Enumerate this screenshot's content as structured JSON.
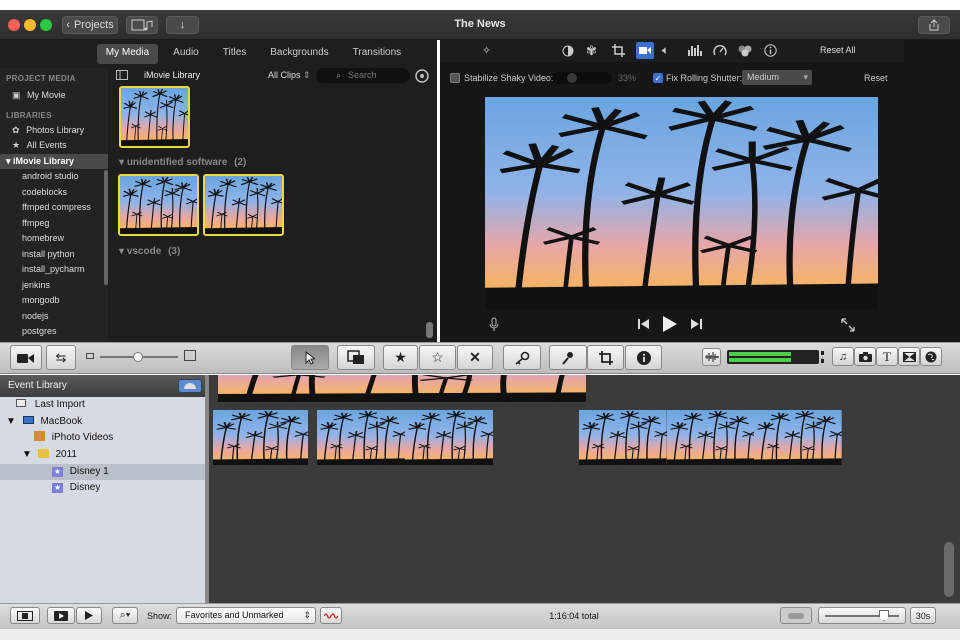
{
  "window": {
    "title": "The News",
    "projects_button": "Projects"
  },
  "media_tabs": [
    "My Media",
    "Audio",
    "Titles",
    "Backgrounds",
    "Transitions"
  ],
  "sidebar": {
    "project_media_header": "PROJECT MEDIA",
    "project": "My Movie",
    "libraries_header": "LIBRARIES",
    "photos_library": "Photos Library",
    "all_events": "All Events",
    "library": "iMovie Library",
    "events": [
      "android studio",
      "codeblocks",
      "ffmped compress",
      "ffmpeg",
      "homebrew",
      "install python",
      "install_pycharm",
      "jenkins",
      "mongodb",
      "nodejs",
      "postgres"
    ]
  },
  "browser": {
    "library_name": "iMovie Library",
    "filter": "All Clips",
    "search_placeholder": "Search",
    "groups": [
      {
        "name": "unidentified software",
        "count": "(2)"
      },
      {
        "name": "vscode",
        "count": "(3)"
      }
    ]
  },
  "viewer": {
    "reset_all": "Reset All",
    "stabilize_label": "Stabilize Shaky Video:",
    "stabilize_value": "33%",
    "rolling_shutter_label": "Fix Rolling Shutter:",
    "rolling_shutter_value": "Medium",
    "reset": "Reset"
  },
  "event_library": {
    "header": "Event Library",
    "items": [
      {
        "label": "Last Import"
      },
      {
        "label": "MacBook"
      },
      {
        "label": "iPhoto Videos"
      },
      {
        "label": "2011"
      },
      {
        "label": "Disney 1"
      },
      {
        "label": "Disney"
      }
    ]
  },
  "bottom_bar": {
    "show_label": "Show:",
    "show_value": "Favorites and Unmarked",
    "total": "1:16:04 total",
    "zoom_value": "30s"
  },
  "colors": {
    "selection_yellow": "#e8d844",
    "meter_green": "#4cd04c"
  }
}
